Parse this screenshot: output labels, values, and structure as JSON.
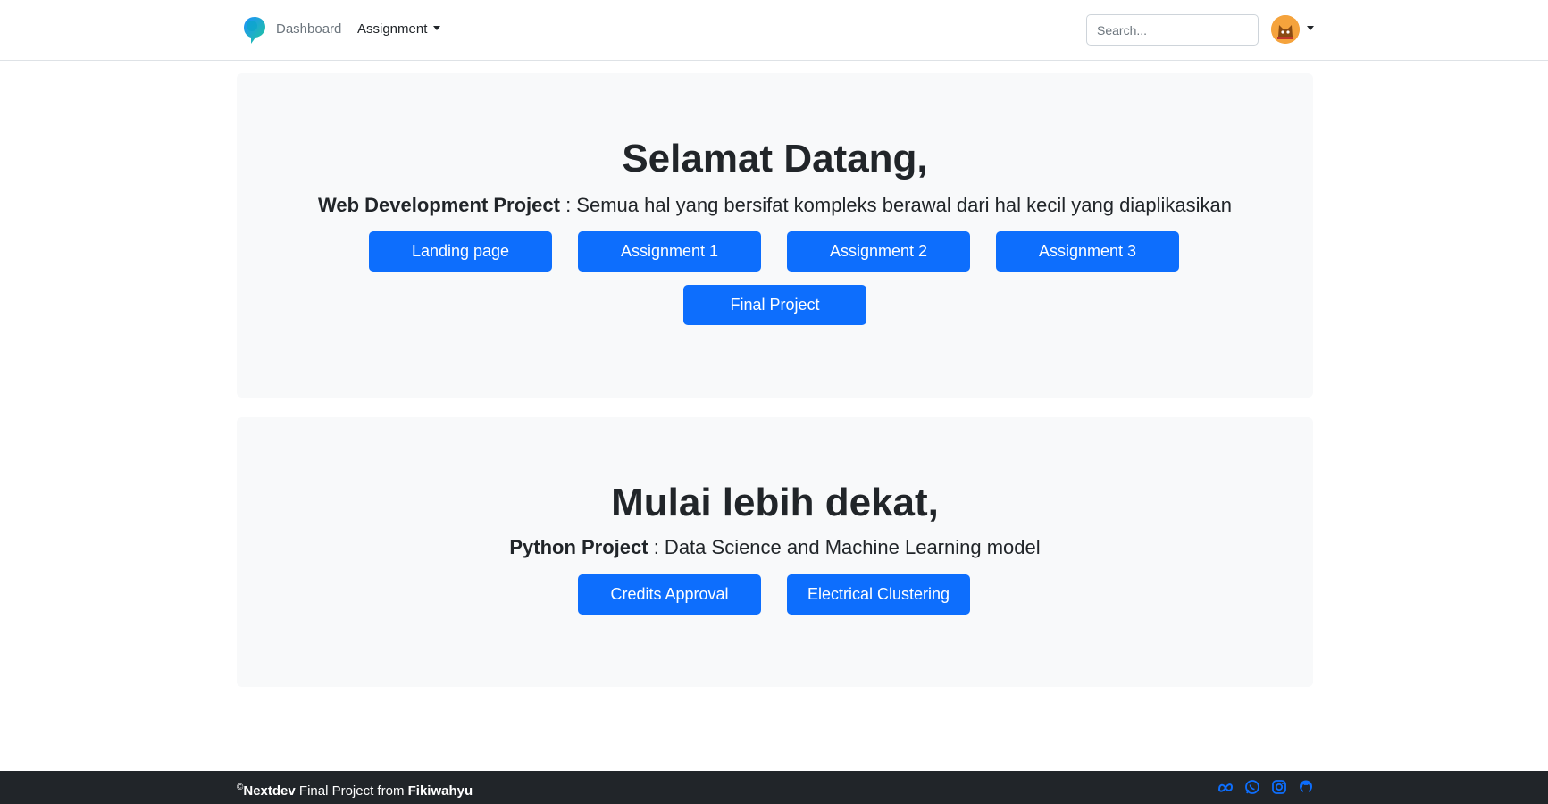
{
  "navbar": {
    "logo_icon": "speech-bubble-logo-icon",
    "links": [
      {
        "label": "Dashboard"
      },
      {
        "label": "Assignment"
      }
    ],
    "search": {
      "placeholder": "Search..."
    },
    "avatar_icon": "user-avatar-icon"
  },
  "welcome": {
    "title": "Selamat Datang,",
    "subtitle_bold": "Web Development Project",
    "subtitle_rest": " : Semua hal yang bersifat kompleks berawal dari hal kecil yang diaplikasikan",
    "buttons": [
      {
        "label": "Landing page"
      },
      {
        "label": "Assignment 1"
      },
      {
        "label": "Assignment 2"
      },
      {
        "label": "Assignment 3"
      },
      {
        "label": "Final Project"
      }
    ]
  },
  "python": {
    "title": "Mulai lebih dekat,",
    "subtitle_bold": "Python Project",
    "subtitle_rest": " : Data Science and Machine Learning model",
    "buttons": [
      {
        "label": "Credits Approval"
      },
      {
        "label": "Electrical Clustering"
      }
    ]
  },
  "footer": {
    "copyright": "©",
    "brand": "Nextdev",
    "middle": " Final Project from ",
    "author": "Fikiwahyu",
    "social_icons": [
      "meta-icon",
      "whatsapp-icon",
      "instagram-icon",
      "github-icon"
    ]
  },
  "colors": {
    "primary": "#0d6efd",
    "section_bg": "#f8f9fa",
    "footer_bg": "#212529"
  }
}
